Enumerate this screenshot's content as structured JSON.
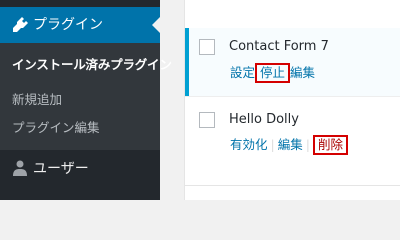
{
  "sidebar": {
    "active_menu": {
      "label": "プラグイン",
      "icon": "plugin-icon"
    },
    "submenu": [
      {
        "label": "インストール済みプラグイン",
        "current": true
      },
      {
        "label": "新規追加",
        "current": false
      },
      {
        "label": "プラグイン編集",
        "current": false
      }
    ],
    "users_menu": {
      "label": "ユーザー",
      "icon": "user-icon"
    }
  },
  "plugins": [
    {
      "name": "Contact Form 7",
      "active": true,
      "actions": {
        "settings": "設定",
        "deactivate": "停止",
        "edit": "編集"
      }
    },
    {
      "name": "Hello Dolly",
      "active": false,
      "actions": {
        "activate": "有効化",
        "edit": "編集",
        "delete": "削除"
      },
      "separator": "|"
    }
  ],
  "colors": {
    "sidebar_bg": "#23282d",
    "active_menu_bg": "#0073aa",
    "link": "#0073aa",
    "delete": "#a00",
    "highlight_box": "#d40000",
    "active_row_border": "#00a0d2"
  }
}
